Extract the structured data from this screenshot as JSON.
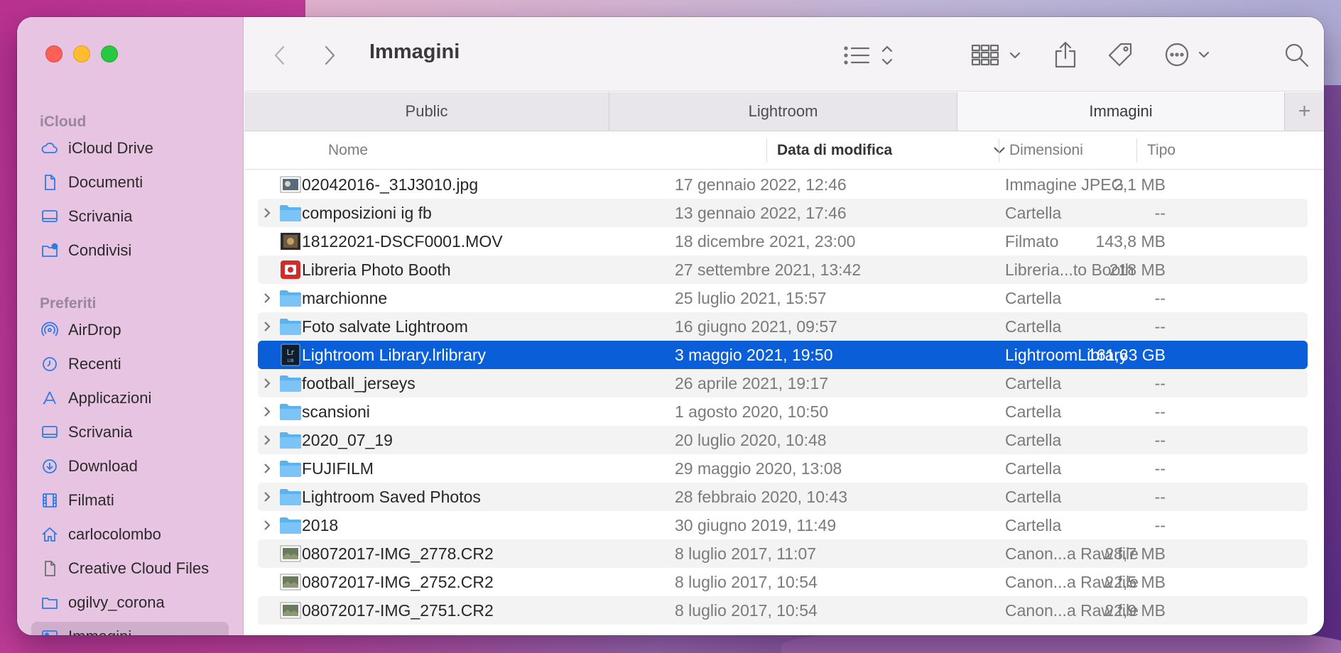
{
  "window": {
    "title": "Immagini"
  },
  "sidebar": {
    "sections": [
      {
        "label": "iCloud",
        "items": [
          {
            "label": "iCloud Drive",
            "icon": "cloud-icon"
          },
          {
            "label": "Documenti",
            "icon": "document-icon"
          },
          {
            "label": "Scrivania",
            "icon": "desktop-icon"
          },
          {
            "label": "Condivisi",
            "icon": "shared-folder-icon"
          }
        ]
      },
      {
        "label": "Preferiti",
        "items": [
          {
            "label": "AirDrop",
            "icon": "airdrop-icon"
          },
          {
            "label": "Recenti",
            "icon": "clock-icon"
          },
          {
            "label": "Applicazioni",
            "icon": "applications-icon"
          },
          {
            "label": "Scrivania",
            "icon": "desktop-icon"
          },
          {
            "label": "Download",
            "icon": "download-icon"
          },
          {
            "label": "Filmati",
            "icon": "film-icon"
          },
          {
            "label": "carlocolombo",
            "icon": "home-icon"
          },
          {
            "label": "Creative Cloud Files",
            "icon": "file-icon"
          },
          {
            "label": "ogilvy_corona",
            "icon": "folder-icon"
          },
          {
            "label": "Immagini",
            "icon": "photo-icon",
            "active": true
          }
        ]
      }
    ]
  },
  "toolbar": {
    "title": "Immagini"
  },
  "tabs": [
    {
      "label": "Public"
    },
    {
      "label": "Lightroom"
    },
    {
      "label": "Immagini",
      "active": true
    }
  ],
  "columns": {
    "name": "Nome",
    "date": "Data di modifica",
    "size": "Dimensioni",
    "kind": "Tipo"
  },
  "files": [
    {
      "name": "02042016-_31J3010.jpg",
      "date": "17 gennaio 2022, 12:46",
      "size": "2,1 MB",
      "kind": "Immagine JPEG",
      "type": "image",
      "folder": false
    },
    {
      "name": "composizioni ig fb",
      "date": "13 gennaio 2022, 17:46",
      "size": "--",
      "kind": "Cartella",
      "type": "folder",
      "folder": true
    },
    {
      "name": "18122021-DSCF0001.MOV",
      "date": "18 dicembre 2021, 23:00",
      "size": "143,8 MB",
      "kind": "Filmato",
      "type": "movie",
      "folder": false
    },
    {
      "name": "Libreria Photo Booth",
      "date": "27 settembre 2021, 13:42",
      "size": "218 MB",
      "kind": "Libreria...to Booth",
      "type": "photobooth",
      "folder": false
    },
    {
      "name": "marchionne",
      "date": "25 luglio 2021, 15:57",
      "size": "--",
      "kind": "Cartella",
      "type": "folder",
      "folder": true
    },
    {
      "name": "Foto salvate Lightroom",
      "date": "16 giugno 2021, 09:57",
      "size": "--",
      "kind": "Cartella",
      "type": "folder",
      "folder": true
    },
    {
      "name": "Lightroom Library.lrlibrary",
      "date": "3 maggio 2021, 19:50",
      "size": "161,63 GB",
      "kind": "LightroomLibrary",
      "type": "lrlibrary",
      "folder": false,
      "selected": true
    },
    {
      "name": "football_jerseys",
      "date": "26 aprile 2021, 19:17",
      "size": "--",
      "kind": "Cartella",
      "type": "folder",
      "folder": true
    },
    {
      "name": "scansioni",
      "date": "1 agosto 2020, 10:50",
      "size": "--",
      "kind": "Cartella",
      "type": "folder",
      "folder": true
    },
    {
      "name": "2020_07_19",
      "date": "20 luglio 2020, 10:48",
      "size": "--",
      "kind": "Cartella",
      "type": "folder",
      "folder": true
    },
    {
      "name": "FUJIFILM",
      "date": "29 maggio 2020, 13:08",
      "size": "--",
      "kind": "Cartella",
      "type": "folder",
      "folder": true
    },
    {
      "name": "Lightroom Saved Photos",
      "date": "28 febbraio 2020, 10:43",
      "size": "--",
      "kind": "Cartella",
      "type": "folder",
      "folder": true
    },
    {
      "name": "2018",
      "date": "30 giugno 2019, 11:49",
      "size": "--",
      "kind": "Cartella",
      "type": "folder",
      "folder": true
    },
    {
      "name": "08072017-IMG_2778.CR2",
      "date": "8 luglio 2017, 11:07",
      "size": "28,7 MB",
      "kind": "Canon...a Raw file",
      "type": "raw",
      "folder": false
    },
    {
      "name": "08072017-IMG_2752.CR2",
      "date": "8 luglio 2017, 10:54",
      "size": "22,5 MB",
      "kind": "Canon...a Raw file",
      "type": "raw",
      "folder": false
    },
    {
      "name": "08072017-IMG_2751.CR2",
      "date": "8 luglio 2017, 10:54",
      "size": "22,9 MB",
      "kind": "Canon...a Raw file",
      "type": "raw",
      "folder": false
    }
  ],
  "colors": {
    "accent": "#0a5fd8",
    "folder": "#5ab2f0",
    "sidebar_icon": "#2d7be4"
  }
}
